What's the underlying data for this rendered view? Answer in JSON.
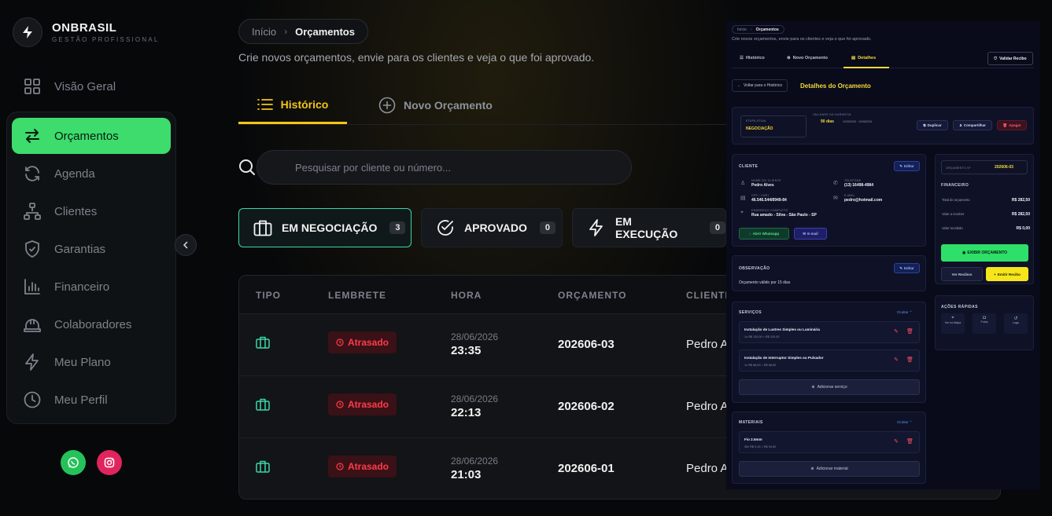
{
  "brand": {
    "title": "ONBRASIL",
    "subtitle": "GESTÃO PROFISSIONAL"
  },
  "sidebar": {
    "items": [
      {
        "label": "Visão Geral",
        "icon": "grid-icon"
      },
      {
        "label": "Orçamentos",
        "icon": "swap-arrows-icon",
        "active": true
      },
      {
        "label": "Agenda",
        "icon": "refresh-icon"
      },
      {
        "label": "Clientes",
        "icon": "network-icon"
      },
      {
        "label": "Garantias",
        "icon": "shield-check-icon"
      },
      {
        "label": "Financeiro",
        "icon": "bar-chart-icon"
      },
      {
        "label": "Colaboradores",
        "icon": "hard-hat-icon"
      },
      {
        "label": "Meu Plano",
        "icon": "lightning-icon"
      },
      {
        "label": "Meu Perfil",
        "icon": "clock-icon"
      }
    ],
    "social": [
      "whatsapp-icon",
      "instagram-icon"
    ]
  },
  "colors": {
    "accent_green": "#3ddc6c",
    "accent_yellow": "#f5c518",
    "teal": "#3bd7a5",
    "danger": "#ff3b4a"
  },
  "main": {
    "breadcrumb": {
      "home": "Início",
      "current": "Orçamentos"
    },
    "subtitle": "Crie novos orçamentos, envie para os clientes e veja o que foi aprovado.",
    "tabs": [
      {
        "label": "Histórico"
      },
      {
        "label": "Novo Orçamento"
      }
    ],
    "search": {
      "placeholder": "Pesquisar por cliente ou número...",
      "value": ""
    },
    "status_cards": [
      {
        "label": "EM NEGOCIAÇÃO",
        "count": "3"
      },
      {
        "label": "APROVADO",
        "count": "0"
      },
      {
        "label": "EM EXECUÇÃO",
        "count": "0"
      }
    ],
    "table": {
      "headers": [
        "TIPO",
        "LEMBRETE",
        "HORA",
        "ORÇAMENTO",
        "CLIENTE"
      ],
      "rows": [
        {
          "reminder": "Atrasado",
          "date": "28/06/2026",
          "time": "23:35",
          "number": "202606-03",
          "client": "Pedro A"
        },
        {
          "reminder": "Atrasado",
          "date": "28/06/2026",
          "time": "22:13",
          "number": "202606-02",
          "client": "Pedro A"
        },
        {
          "reminder": "Atrasado",
          "date": "28/06/2026",
          "time": "21:03",
          "number": "202606-01",
          "client": "Pedro A"
        }
      ]
    }
  },
  "overlay": {
    "breadcrumb": {
      "home": "Início",
      "current": "Orçamentos"
    },
    "subtitle": "Crie novos orçamentos, envie para os clientes e veja o que foi aprovado.",
    "tabs": [
      "Histórico",
      "Novo Orçamento",
      "Detalhes"
    ],
    "validate_button": "Validar Recibo",
    "back_button": "Voltar para o Histórico",
    "title": "Detalhes do Orçamento",
    "stage": {
      "label": "ETAPA ATUAL",
      "value": "NEGOCIAÇÃO"
    },
    "warranty": {
      "label": "VALIDADE DA GARANTIA",
      "value": "90 dias",
      "range": "10/03/2026 · 10/06/2026"
    },
    "actions": [
      "Duplicar",
      "Compartilhar",
      "Apagar"
    ],
    "client": {
      "heading": "CLIENTE",
      "edit": "Editar",
      "name_label": "NOME DO CLIENTE",
      "name": "Pedro Alves",
      "phone_label": "TELEFONE",
      "phone": "(13) 16498-4984",
      "doc_label": "CPF / CNPJ",
      "doc": "46.546.544/8949-84",
      "email_label": "E-MAIL",
      "email": "pedro@hotmail.com",
      "address_label": "ENDEREÇO COMPLETO",
      "address": "Rua amado - Silva - São Paulo - SP",
      "whatsapp": "Abrir Whatsapp",
      "email_btn": "E-mail"
    },
    "observation": {
      "heading": "OBSERVAÇÃO",
      "edit": "Editar",
      "text": "Orçamento válido por 15 dias"
    },
    "services": {
      "heading": "SERVIÇOS",
      "toggle": "Ocultar",
      "add": "Adicionar serviço",
      "items": [
        {
          "name": "Instalação de Lustres Simples ou Luminária",
          "detail": "1x R$ 120,00 = R$ 120,00"
        },
        {
          "name": "Instalação de Interruptor Simples ou Pulsador",
          "detail": "1x R$ 68,00 = R$ 68,00"
        }
      ]
    },
    "materials": {
      "heading": "MATERIAIS",
      "toggle": "Ocultar",
      "add": "Adicionar material",
      "items": [
        {
          "name": "Fio 2.5mm",
          "detail": "30x R$ 3,15 = R$ 94,50"
        }
      ]
    },
    "summary": {
      "number_label": "ORÇAMENTO Nº",
      "number": "202606-03",
      "financial": "FINANCEIRO",
      "rows": [
        {
          "label": "Total do orçamento",
          "value": "R$ 282,50"
        },
        {
          "label": "Valor a receber",
          "value": "R$ 282,50"
        },
        {
          "label": "Valor recebido",
          "value": "R$ 0,00"
        }
      ],
      "view_button": "EXIBIR ORÇAMENTO",
      "receipts": "Ver Recibos",
      "issue_receipt": "Emitir Recibo"
    },
    "quick_actions": {
      "heading": "AÇÕES RÁPIDAS",
      "items": [
        "Ver no Mapa",
        "Fotos",
        "Logs"
      ]
    }
  }
}
